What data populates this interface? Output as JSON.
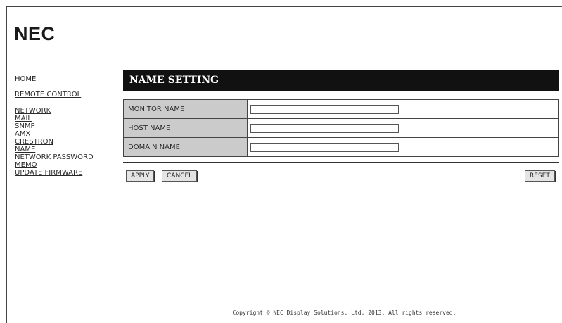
{
  "brand": {
    "logo": "NEC"
  },
  "nav": [
    {
      "label": "HOME"
    },
    {
      "label": "REMOTE CONTROL"
    },
    {
      "label": "NETWORK"
    },
    {
      "label": "MAIL"
    },
    {
      "label": "SNMP"
    },
    {
      "label": "AMX"
    },
    {
      "label": "CRESTRON"
    },
    {
      "label": "NAME"
    },
    {
      "label": "NETWORK PASSWORD"
    },
    {
      "label": "MEMO"
    },
    {
      "label": "UPDATE FIRMWARE"
    }
  ],
  "page": {
    "title": "NAME SETTING"
  },
  "form": {
    "rows": [
      {
        "label": "MONITOR NAME",
        "value": ""
      },
      {
        "label": "HOST NAME",
        "value": ""
      },
      {
        "label": "DOMAIN NAME",
        "value": ""
      }
    ]
  },
  "buttons": {
    "apply": "APPLY",
    "cancel": "CANCEL",
    "reset": "RESET"
  },
  "footer": {
    "copyright": "Copyright © NEC Display Solutions, Ltd. 2013. All rights reserved."
  }
}
